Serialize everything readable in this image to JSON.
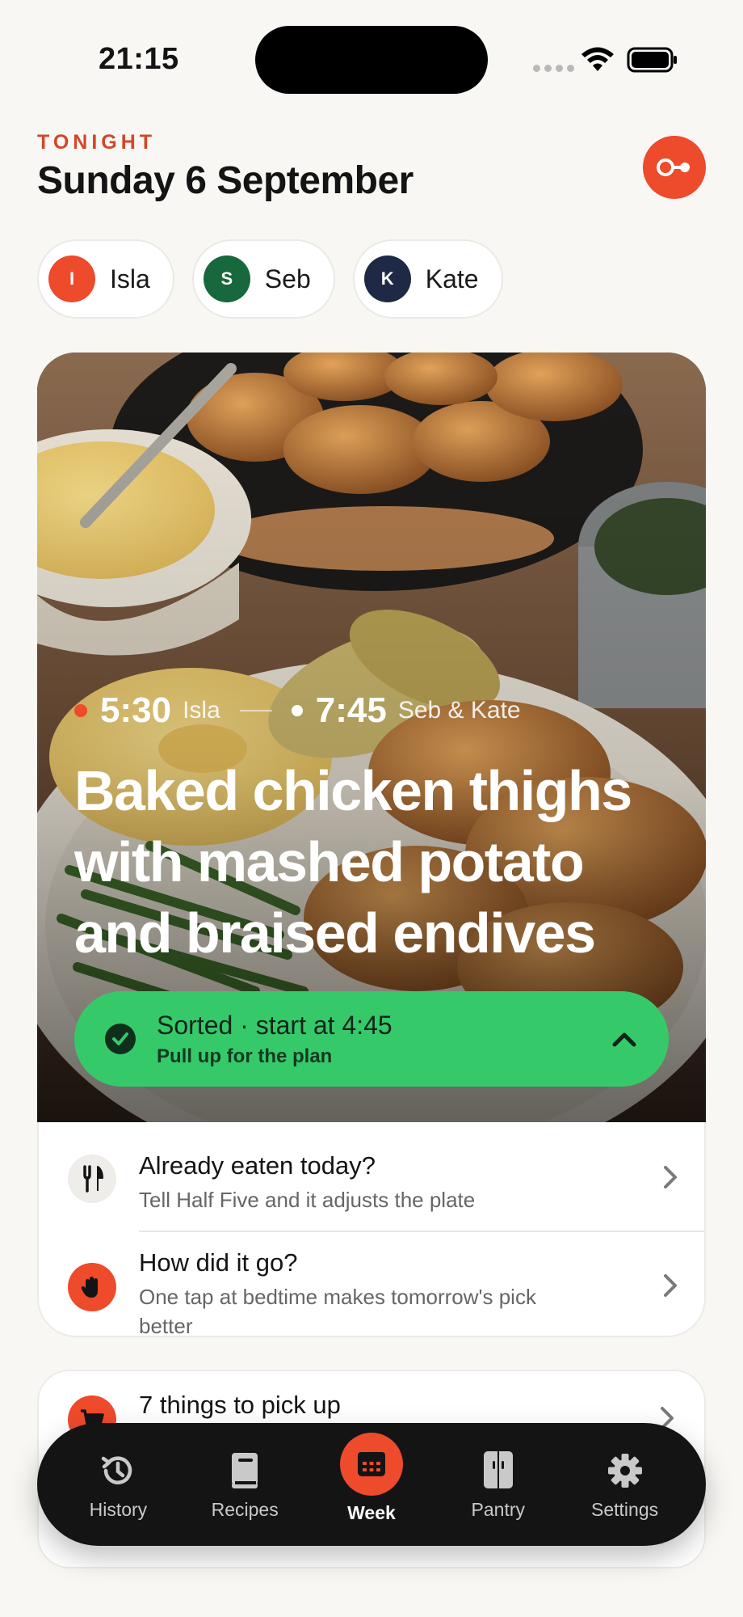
{
  "status_bar": {
    "time": "21:15"
  },
  "header": {
    "eyebrow": "TONIGHT",
    "title": "Sunday 6 September"
  },
  "people": [
    {
      "initial": "I",
      "name": "Isla",
      "color": "#ee4a2c"
    },
    {
      "initial": "S",
      "name": "Seb",
      "color": "#17683d"
    },
    {
      "initial": "K",
      "name": "Kate",
      "color": "#1e2a45"
    }
  ],
  "hero": {
    "first_time": "5:30",
    "first_who": "Isla",
    "second_time": "7:45",
    "second_who": "Seb & Kate",
    "meal_title": "Baked chicken thighs with mashed potato and braised endives",
    "status_title": "Sorted · start at 4:45",
    "status_sub": "Pull up for the plan"
  },
  "list": [
    {
      "icon": "fork-knife-icon",
      "title": "Already eaten today?",
      "sub": "Tell Half Five and it adjusts the plate"
    },
    {
      "icon": "hand-wave-icon",
      "title": "How did it go?",
      "sub": "One tap at bedtime makes tomorrow's pick better"
    }
  ],
  "pickup": {
    "icon": "cart-icon",
    "title": "7 things to pick up"
  },
  "tabs": [
    {
      "label": "History",
      "icon": "history-icon"
    },
    {
      "label": "Recipes",
      "icon": "book-icon"
    },
    {
      "label": "Week",
      "icon": "calendar-icon",
      "active": true
    },
    {
      "label": "Pantry",
      "icon": "pantry-icon"
    },
    {
      "label": "Settings",
      "icon": "gear-icon"
    }
  ],
  "colors": {
    "accent": "#ee4a2c",
    "success": "#36c96a",
    "background": "#f8f7f4"
  }
}
